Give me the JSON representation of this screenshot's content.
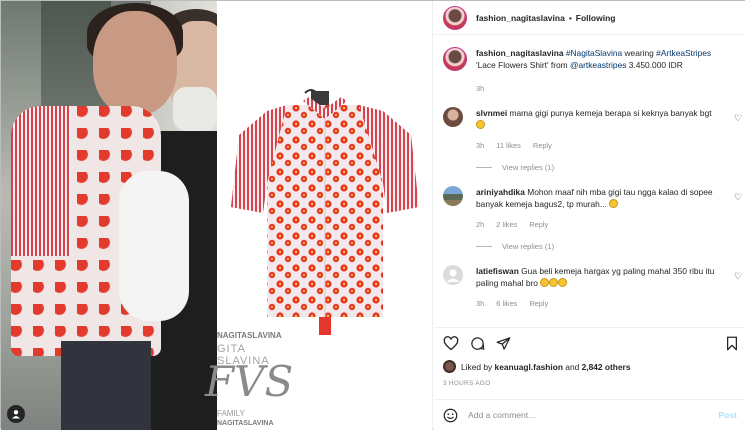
{
  "post": {
    "username": "fashion_nagitaslavina",
    "follow_status": "Following",
    "separator": "•"
  },
  "watermark": {
    "line1": "NAGITASLAVINA",
    "line2": "GITA SLAVINA",
    "logo": "FVS",
    "line3": "FAMILY",
    "line4": "NAGITASLAVINA"
  },
  "caption": {
    "username": "fashion_nagitaslavina",
    "hashtag1": "#NagitaSlavina",
    "text1": "wearing",
    "hashtag2": "#ArtkeaStripes",
    "text2": "'Lace Flowers Shirt' from",
    "mention": "@artkeastripes",
    "text3": "3.450.000 IDR",
    "time": "3h"
  },
  "comments": [
    {
      "username": "slvnmei",
      "text": "mama gigi punya kemeja berapa si keknya banyak bgt",
      "time": "3h",
      "likes": "11 likes",
      "reply": "Reply",
      "view_replies": "View replies (1)"
    },
    {
      "username": "ariniyahdika",
      "text": "Mohon maaf nih mba gigi tau ngga kalao di sopee banyak kemeja bagus2, tp murah...",
      "time": "2h",
      "likes": "2 likes",
      "reply": "Reply",
      "view_replies": "View replies (1)"
    },
    {
      "username": "latiefiswan",
      "text": "Gua beli kemeja hargax yg paling mahal 350 ribu itu paling mahal bro",
      "time": "3h",
      "likes": "6 likes",
      "reply": "Reply"
    }
  ],
  "likes": {
    "prefix": "Liked by",
    "user": "keanuagl.fashion",
    "conj": "and",
    "count": "2,842 others"
  },
  "posted_ago": "3 HOURS AGO",
  "composer": {
    "placeholder": "Add a comment...",
    "post_label": "Post"
  },
  "icons": {
    "heart": "heart-icon",
    "comment": "comment-icon",
    "share": "share-icon",
    "save": "bookmark-icon",
    "emoji": "emoji-icon",
    "user": "user-tag-icon"
  },
  "colors": {
    "link": "#00376b",
    "muted": "#8e8e8e",
    "post_disabled": "#b2dffc",
    "shirt_red": "#e23a2c"
  }
}
